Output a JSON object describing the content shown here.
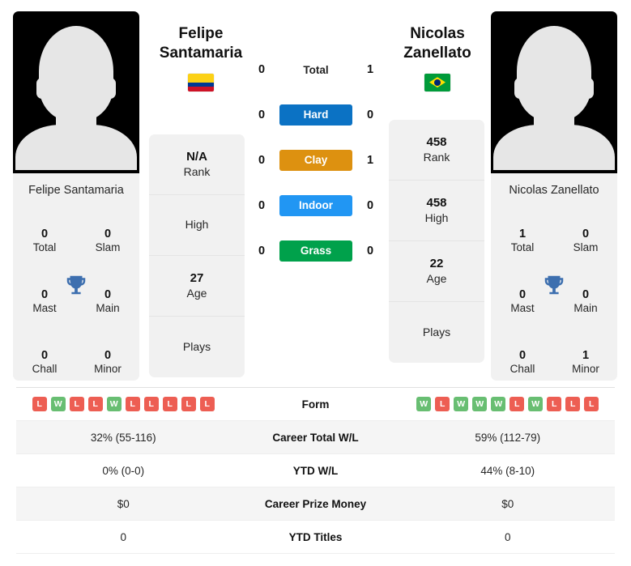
{
  "players": {
    "left": {
      "first_name": "Felipe",
      "last_name": "Santamaria",
      "full_name": "Felipe Santamaria",
      "country_flag": "colombia-flag",
      "photo_alt": "player-silhouette",
      "titles": {
        "total_value": "0",
        "total_label": "Total",
        "slam_value": "0",
        "slam_label": "Slam",
        "mast_value": "0",
        "mast_label": "Mast",
        "main_value": "0",
        "main_label": "Main",
        "chall_value": "0",
        "chall_label": "Chall",
        "minor_value": "0",
        "minor_label": "Minor"
      },
      "profile": {
        "rank_value": "N/A",
        "rank_label": "Rank",
        "high_value": "",
        "high_label": "High",
        "age_value": "27",
        "age_label": "Age",
        "plays_value": "",
        "plays_label": "Plays"
      },
      "h2h": {
        "total": "0",
        "hard": "0",
        "clay": "0",
        "indoor": "0",
        "grass": "0"
      },
      "form": [
        "L",
        "W",
        "L",
        "L",
        "W",
        "L",
        "L",
        "L",
        "L",
        "L"
      ],
      "career_total_wl": "32% (55-116)",
      "ytd_wl": "0% (0-0)",
      "career_prize_money": "$0",
      "ytd_titles": "0"
    },
    "right": {
      "first_name": "Nicolas",
      "last_name": "Zanellato",
      "full_name": "Nicolas Zanellato",
      "country_flag": "brazil-flag",
      "photo_alt": "player-silhouette",
      "titles": {
        "total_value": "1",
        "total_label": "Total",
        "slam_value": "0",
        "slam_label": "Slam",
        "mast_value": "0",
        "mast_label": "Mast",
        "main_value": "0",
        "main_label": "Main",
        "chall_value": "0",
        "chall_label": "Chall",
        "minor_value": "1",
        "minor_label": "Minor"
      },
      "profile": {
        "rank_value": "458",
        "rank_label": "Rank",
        "high_value": "458",
        "high_label": "High",
        "age_value": "22",
        "age_label": "Age",
        "plays_value": "",
        "plays_label": "Plays"
      },
      "h2h": {
        "total": "1",
        "hard": "0",
        "clay": "1",
        "indoor": "0",
        "grass": "0"
      },
      "form": [
        "W",
        "L",
        "W",
        "W",
        "W",
        "L",
        "W",
        "L",
        "L",
        "L"
      ],
      "career_total_wl": "59% (112-79)",
      "ytd_wl": "44% (8-10)",
      "career_prize_money": "$0",
      "ytd_titles": "0"
    }
  },
  "surfaces": {
    "total_label": "Total",
    "hard_label": "Hard",
    "clay_label": "Clay",
    "indoor_label": "Indoor",
    "grass_label": "Grass"
  },
  "stats_labels": {
    "form": "Form",
    "career_total_wl": "Career Total W/L",
    "ytd_wl": "YTD W/L",
    "career_prize_money": "Career Prize Money",
    "ytd_titles": "YTD Titles"
  },
  "colors": {
    "hard": "#0b72c4",
    "clay": "#dd9110",
    "indoor": "#2196f3",
    "grass": "#00a14b",
    "win": "#68be72",
    "loss": "#ed5e53",
    "trophy": "#3d6faf",
    "card_bg": "#f1f1f1",
    "row_alt_bg": "#f5f5f5"
  }
}
